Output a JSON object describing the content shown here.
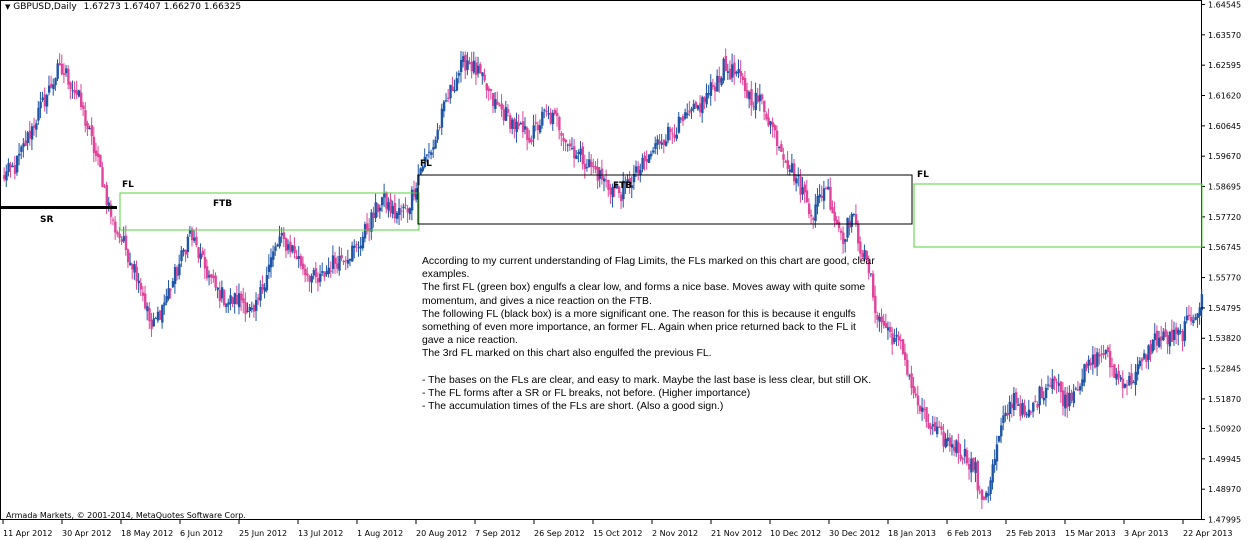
{
  "header": {
    "symbol_label": "GBPUSD,Daily",
    "ohlc": "1.67273 1.67407 1.66270 1.66325"
  },
  "footer": {
    "copyright": "Armada Markets, © 2001-2014, MetaQuotes Software Corp."
  },
  "annotations": {
    "sr_label": "SR",
    "fl_labels": [
      "FL",
      "FL",
      "FL"
    ],
    "ftb_labels": [
      "FTB",
      "FTB"
    ]
  },
  "commentary": [
    "According to my current understanding of Flag Limits, the FLs marked on this chart are good, clear",
    "examples.",
    "The first FL (green box) engulfs a clear low, and forms a nice base. Moves away with quite some",
    "momentum, and gives a nice reaction on the FTB.",
    "The following FL (black box) is a more significant one. The reason for this is because it engulfs",
    "something of even more importance, an former FL. Again when price returned back to the FL it",
    "gave a nice reaction.",
    "The 3rd FL marked on this chart also engulfed the previous FL.",
    "",
    "- The bases on the FLs are clear, and easy to mark. Maybe the last base is less clear, but still OK.",
    "- The FL forms after a SR or FL breaks, not before. (Higher importance)",
    "- The accumulation times of the FLs are short. (Also a good sign.)"
  ],
  "colors": {
    "bull": "#1f55a6",
    "bear": "#e0449b",
    "green_box": "#54d13e",
    "black_box": "#000000",
    "background": "#ffffff"
  },
  "chart_data": {
    "type": "candlestick",
    "title": "GBPUSD,Daily",
    "y_ticks": [
      "1.64545",
      "1.63570",
      "1.62595",
      "1.61620",
      "1.60645",
      "1.59670",
      "1.58695",
      "1.57720",
      "1.56745",
      "1.55770",
      "1.54795",
      "1.53820",
      "1.52845",
      "1.51870",
      "1.50920",
      "1.49945",
      "1.48970",
      "1.47995"
    ],
    "ylim": [
      1.4798,
      1.6456
    ],
    "x_ticks": [
      "11 Apr 2012",
      "30 Apr 2012",
      "18 May 2012",
      "6 Jun 2012",
      "25 Jun 2012",
      "13 Jul 2012",
      "1 Aug 2012",
      "20 Aug 2012",
      "7 Sep 2012",
      "26 Sep 2012",
      "15 Oct 2012",
      "2 Nov 2012",
      "21 Nov 2012",
      "10 Dec 2012",
      "30 Dec 2012",
      "18 Jan 2013",
      "6 Feb 2013",
      "25 Feb 2013",
      "15 Mar 2013",
      "3 Apr 2013",
      "22 Apr 2013"
    ],
    "close_path": [
      [
        0,
        1.59
      ],
      [
        6,
        1.593
      ],
      [
        16,
        1.609
      ],
      [
        26,
        1.624
      ],
      [
        30,
        1.623
      ],
      [
        36,
        1.615
      ],
      [
        46,
        1.592
      ],
      [
        52,
        1.575
      ],
      [
        58,
        1.567
      ],
      [
        64,
        1.558
      ],
      [
        70,
        1.541
      ],
      [
        76,
        1.55
      ],
      [
        82,
        1.56
      ],
      [
        88,
        1.572
      ],
      [
        94,
        1.562
      ],
      [
        100,
        1.554
      ],
      [
        106,
        1.55
      ],
      [
        112,
        1.551
      ],
      [
        118,
        1.545
      ],
      [
        124,
        1.56
      ],
      [
        130,
        1.57
      ],
      [
        136,
        1.567
      ],
      [
        142,
        1.56
      ],
      [
        148,
        1.556
      ],
      [
        154,
        1.562
      ],
      [
        160,
        1.565
      ],
      [
        166,
        1.567
      ],
      [
        172,
        1.575
      ],
      [
        178,
        1.583
      ],
      [
        184,
        1.578
      ],
      [
        190,
        1.58
      ],
      [
        196,
        1.593
      ],
      [
        202,
        1.6
      ],
      [
        208,
        1.614
      ],
      [
        214,
        1.624
      ],
      [
        218,
        1.628
      ],
      [
        224,
        1.622
      ],
      [
        230,
        1.614
      ],
      [
        236,
        1.61
      ],
      [
        242,
        1.605
      ],
      [
        248,
        1.603
      ],
      [
        254,
        1.61
      ],
      [
        260,
        1.608
      ],
      [
        266,
        1.6
      ],
      [
        272,
        1.596
      ],
      [
        278,
        1.592
      ],
      [
        284,
        1.587
      ],
      [
        290,
        1.585
      ],
      [
        296,
        1.59
      ],
      [
        302,
        1.595
      ],
      [
        308,
        1.602
      ],
      [
        314,
        1.605
      ],
      [
        320,
        1.608
      ],
      [
        326,
        1.612
      ],
      [
        332,
        1.618
      ],
      [
        338,
        1.625
      ],
      [
        344,
        1.623
      ],
      [
        350,
        1.616
      ],
      [
        356,
        1.614
      ],
      [
        362,
        1.604
      ],
      [
        368,
        1.595
      ],
      [
        374,
        1.587
      ],
      [
        380,
        1.578
      ],
      [
        382,
        1.582
      ],
      [
        386,
        1.588
      ],
      [
        390,
        1.577
      ],
      [
        394,
        1.571
      ],
      [
        398,
        1.578
      ],
      [
        402,
        1.568
      ],
      [
        406,
        1.56
      ],
      [
        410,
        1.545
      ],
      [
        416,
        1.54
      ],
      [
        422,
        1.534
      ],
      [
        428,
        1.518
      ],
      [
        434,
        1.51
      ],
      [
        440,
        1.506
      ],
      [
        446,
        1.504
      ],
      [
        452,
        1.5
      ],
      [
        456,
        1.496
      ],
      [
        458,
        1.486
      ],
      [
        462,
        1.49
      ],
      [
        468,
        1.509
      ],
      [
        474,
        1.52
      ],
      [
        480,
        1.512
      ],
      [
        486,
        1.52
      ],
      [
        492,
        1.526
      ],
      [
        498,
        1.518
      ],
      [
        504,
        1.524
      ],
      [
        510,
        1.53
      ],
      [
        516,
        1.534
      ],
      [
        522,
        1.526
      ],
      [
        528,
        1.524
      ],
      [
        534,
        1.53
      ],
      [
        540,
        1.538
      ],
      [
        546,
        1.538
      ],
      [
        552,
        1.539
      ],
      [
        558,
        1.546
      ],
      [
        562,
        1.55
      ]
    ]
  }
}
